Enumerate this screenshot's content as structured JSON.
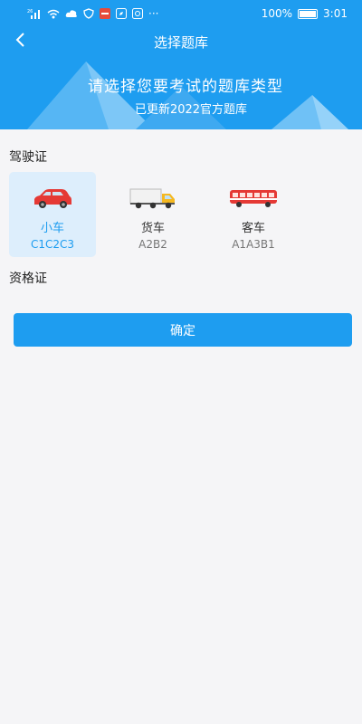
{
  "status_bar": {
    "signal_label": "26",
    "more": "···",
    "battery": "100%",
    "time": "3:01"
  },
  "nav": {
    "title": "选择题库"
  },
  "banner": {
    "title": "请选择您要考试的题库类型",
    "subtitle": "已更新2022官方题库"
  },
  "sections": {
    "license": "驾驶证",
    "qualification": "资格证"
  },
  "options": [
    {
      "name": "小车",
      "code": "C1C2C3",
      "selected": true
    },
    {
      "name": "货车",
      "code": "A2B2",
      "selected": false
    },
    {
      "name": "客车",
      "code": "A1A3B1",
      "selected": false
    }
  ],
  "confirm_label": "确定",
  "colors": {
    "accent": "#1e9df0",
    "selected_bg": "#ddeefc"
  }
}
